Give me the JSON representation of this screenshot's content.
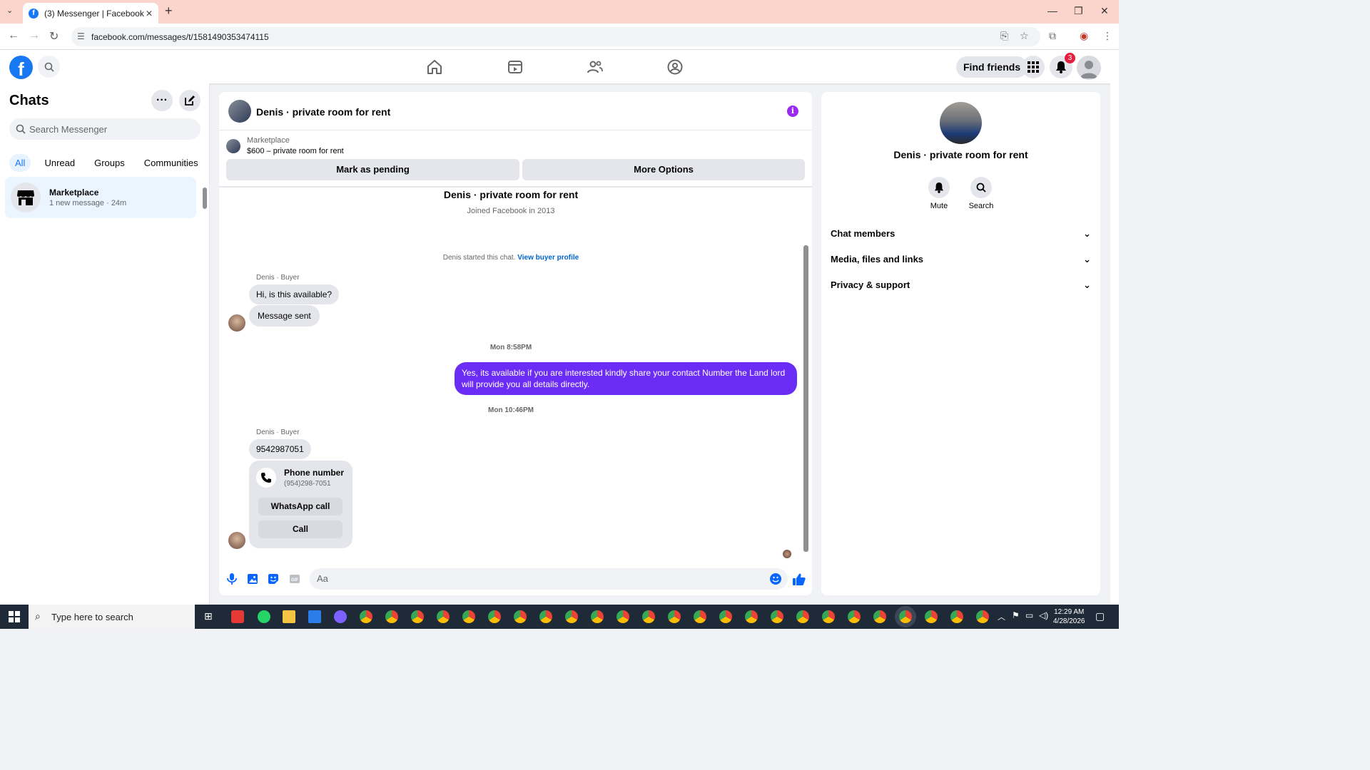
{
  "browser": {
    "tab_title": "(3) Messenger | Facebook",
    "url": "facebook.com/messages/t/1581490353474115"
  },
  "header": {
    "find_friends": "Find friends",
    "notification_count": "3"
  },
  "sidebar": {
    "title": "Chats",
    "search_placeholder": "Search Messenger",
    "filters": [
      "All",
      "Unread",
      "Groups",
      "Communities"
    ],
    "chats": [
      {
        "name": "Marketplace",
        "preview": "1 new message · 24m"
      }
    ]
  },
  "conversation": {
    "title": "Denis · private room for rent",
    "marketplace_label": "Marketplace",
    "listing": "$600 – private room for rent",
    "mark_pending": "Mark as pending",
    "more_options": "More Options",
    "profile_name": "Denis · private room for rent",
    "joined": "Joined Facebook in 2013",
    "started_text": "Denis started this chat.",
    "view_buyer_profile": "View buyer profile",
    "sender_label": "Denis · Buyer",
    "msg1": "Hi, is this available?",
    "msg2": "Message sent",
    "time1": "Mon 8:58PM",
    "outgoing": "Yes, its available if you are interested kindly share your contact Number the Land lord will provide you all details directly.",
    "time2": "Mon 10:46PM",
    "msg3": "9542987051",
    "card_title": "Phone number",
    "card_number": "(954)298-7051",
    "whatsapp_call": "WhatsApp call",
    "call": "Call",
    "composer_placeholder": "Aa"
  },
  "details": {
    "name": "Denis · private room for rent",
    "mute": "Mute",
    "search": "Search",
    "sections": [
      "Chat members",
      "Media, files and links",
      "Privacy & support"
    ]
  },
  "taskbar": {
    "search_placeholder": "Type here to search",
    "time": "12:29 AM",
    "date": "4/28/2026"
  },
  "colors": {
    "fb_blue": "#1877f2",
    "outgoing_bubble": "#6b2cf5",
    "incoming_bubble": "#e4e6eb"
  }
}
